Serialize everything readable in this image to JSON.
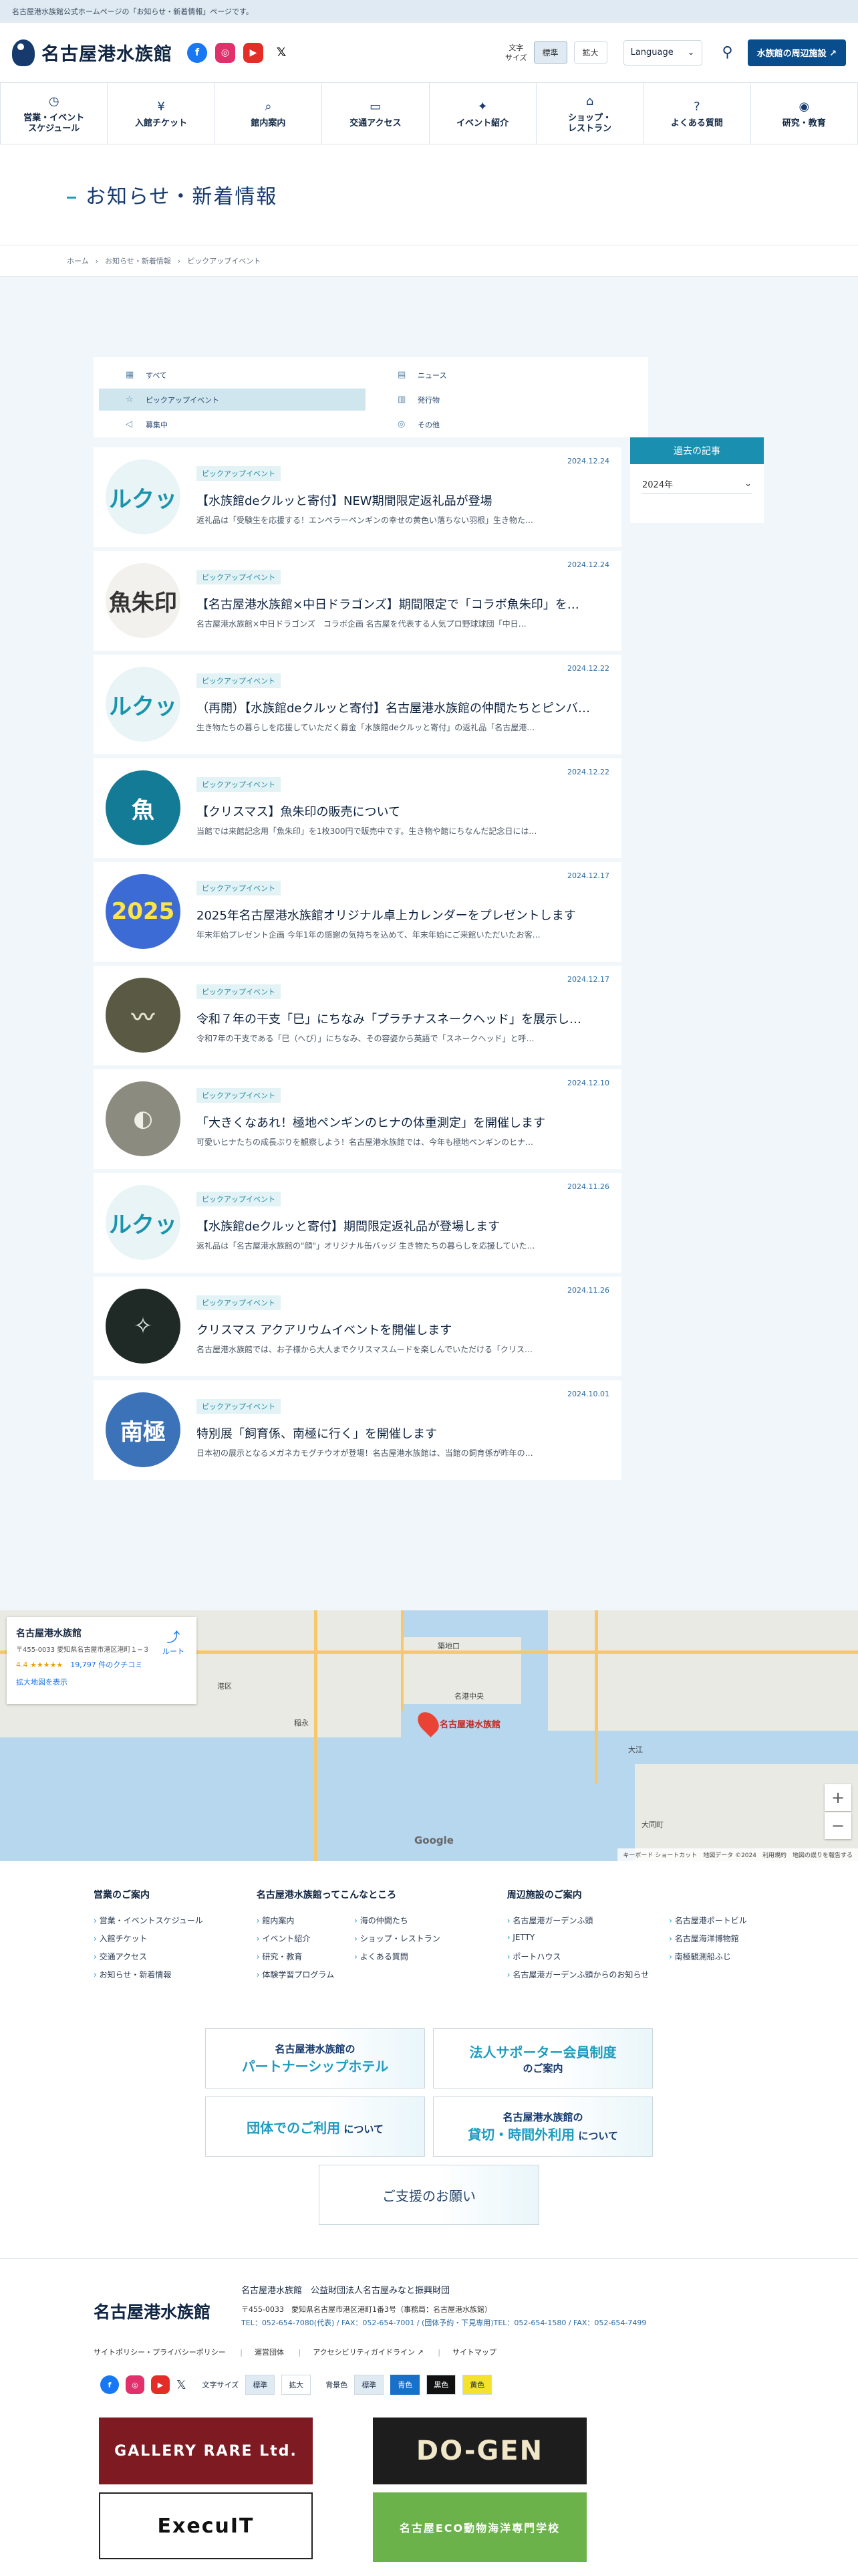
{
  "topbar": {
    "text": "名古屋港水族館公式ホームページの「お知らせ・新着情報」ページです。"
  },
  "header": {
    "logo_text": "名古屋港水族館",
    "sns": {
      "facebook": "f",
      "instagram": "◎",
      "youtube": "▶",
      "x": "𝕏"
    },
    "font_size_label": "文字\nサイズ",
    "font_standard": "標準",
    "font_large": "拡大",
    "language": "Language",
    "nearby_button": "水族館の周辺施設 ↗"
  },
  "gnav": [
    {
      "label": "営業・イベント\nスケジュール",
      "icon": "clock-icon",
      "glyph": "◷"
    },
    {
      "label": "入館チケット",
      "icon": "ticket-icon",
      "glyph": "¥"
    },
    {
      "label": "館内案内",
      "icon": "map-search-icon",
      "glyph": "⌕"
    },
    {
      "label": "交通アクセス",
      "icon": "bus-icon",
      "glyph": "▭"
    },
    {
      "label": "イベント紹介",
      "icon": "event-icon",
      "glyph": "✦"
    },
    {
      "label": "ショップ・\nレストラン",
      "icon": "shop-icon",
      "glyph": "⌂"
    },
    {
      "label": "よくある質問",
      "icon": "question-icon",
      "glyph": "?"
    },
    {
      "label": "研究・教育",
      "icon": "research-icon",
      "glyph": "◉"
    }
  ],
  "page": {
    "title": "お知らせ・新着情報"
  },
  "breadcrumb": [
    "ホーム",
    "お知らせ・新着情報",
    "ピックアップイベント"
  ],
  "filters": [
    {
      "label": "すべて",
      "icon": "grid-icon",
      "glyph": "▦",
      "active": false
    },
    {
      "label": "ニュース",
      "icon": "news-icon",
      "glyph": "▤",
      "active": false
    },
    {
      "label": "ピックアップイベント",
      "icon": "pickup-icon",
      "glyph": "☆",
      "active": true
    },
    {
      "label": "発行物",
      "icon": "book-icon",
      "glyph": "▥",
      "active": false
    },
    {
      "label": "募集中",
      "icon": "megaphone-icon",
      "glyph": "◁",
      "active": false
    },
    {
      "label": "その他",
      "icon": "other-icon",
      "glyph": "◎",
      "active": false
    }
  ],
  "archive": {
    "title": "過去の記事",
    "year": "2024年"
  },
  "tag_label": "ピックアップイベント",
  "articles": [
    {
      "date": "2024.12.24",
      "title": "【水族館deクルッと寄付】NEW期間限定返礼品が登場",
      "excerpt": "返礼品は「受験生を応援する！エンペラーペンギンの幸せの黄色い落ちない羽根」生き物た…",
      "thumb": "ルクッ",
      "bg": "#e9f4f6",
      "fg": "#1a93ad"
    },
    {
      "date": "2024.12.24",
      "title": "【名古屋港水族館×中日ドラゴンズ】期間限定で「コラボ魚朱印」を…",
      "excerpt": "名古屋港水族館×中日ドラゴンズ　コラボ企画 名古屋を代表する人気プロ野球球団「中日…",
      "thumb": "魚朱印",
      "bg": "#f3f1ee",
      "fg": "#333"
    },
    {
      "date": "2024.12.22",
      "title": "（再開）【水族館deクルッと寄付】名古屋港水族館の仲間たちとピンバ…",
      "excerpt": "生き物たちの暮らしを応援していただく募金「水族館deクルッと寄付」の返礼品「名古屋港…",
      "thumb": "ルクッ",
      "bg": "#e9f4f6",
      "fg": "#1a93ad"
    },
    {
      "date": "2024.12.22",
      "title": "【クリスマス】魚朱印の販売について",
      "excerpt": "当館では来館記念用「魚朱印」を1枚300円で販売中です。生き物や館にちなんだ記念日には…",
      "thumb": "魚",
      "bg": "#137b96",
      "fg": "#fff"
    },
    {
      "date": "2024.12.17",
      "title": "2025年名古屋港水族館オリジナル卓上カレンダーをプレゼントします",
      "excerpt": "年末年始プレゼント企画 今年1年の感謝の気持ちを込めて、年末年始にご来館いただいたお客…",
      "thumb": "2025",
      "bg": "#3d6bd6",
      "fg": "#ffe34d"
    },
    {
      "date": "2024.12.17",
      "title": "令和７年の干支「巳」にちなみ「プラチナスネークヘッド」を展示し…",
      "excerpt": "令和7年の干支である「巳（へび）」にちなみ、その容姿から英語で「スネークヘッド」と呼…",
      "thumb": "〰",
      "bg": "#5a5a44",
      "fg": "#e6e0c8"
    },
    {
      "date": "2024.12.10",
      "title": "「大きくなあれ！極地ペンギンのヒナの体重測定」を開催します",
      "excerpt": "可愛いヒナたちの成長ぶりを観察しよう！名古屋港水族館では、今年も極地ペンギンのヒナ…",
      "thumb": "◐",
      "bg": "#8b8b80",
      "fg": "#efefe8"
    },
    {
      "date": "2024.11.26",
      "title": "【水族館deクルッと寄付】期間限定返礼品が登場します",
      "excerpt": "返礼品は「名古屋港水族館の\"顔\"」オリジナル缶バッジ 生き物たちの暮らしを応援していた…",
      "thumb": "ルクッ",
      "bg": "#e9f4f6",
      "fg": "#1a93ad"
    },
    {
      "date": "2024.11.26",
      "title": "クリスマス アクアリウムイベントを開催します",
      "excerpt": "名古屋港水族館では、お子様から大人までクリスマスムードを楽しんでいただける「クリス…",
      "thumb": "✧",
      "bg": "#1f2a26",
      "fg": "#dbe8e0"
    },
    {
      "date": "2024.10.01",
      "title": "特別展「飼育係、南極に行く」を開催します",
      "excerpt": "日本初の展示となるメガネカモグチウオが登場！名古屋港水族館は、当館の飼育係が昨年の…",
      "thumb": "南極",
      "bg": "#3b72b8",
      "fg": "#fff"
    }
  ],
  "map": {
    "name": "名古屋港水族館",
    "address": "〒455-0033 愛知県名古屋市港区港町１−３",
    "route": "ルート",
    "rating": "4.4 ★★★★★",
    "reviews": "19,797 件のクチコミ",
    "enlarge": "拡大地図を表示",
    "pin_label": "名古屋港水族館",
    "google": "Google",
    "attribution": "キーボード ショートカット　地図データ ©2024　利用規約　地図の誤りを報告する",
    "zoom_in": "+",
    "zoom_out": "−",
    "labels": [
      "港区",
      "築地口",
      "稲永",
      "大江",
      "名古屋港水族館",
      "名港中央",
      "大同町"
    ]
  },
  "footer_nav": [
    {
      "heading": "営業のご案内",
      "items": [
        "営業・イベントスケジュール",
        "入館チケット",
        "交通アクセス",
        "お知らせ・新着情報"
      ]
    },
    {
      "heading": "名古屋港水族館ってこんなところ",
      "items": [
        "館内案内",
        "海の仲間たち",
        "イベント紹介",
        "ショップ・レストラン",
        "研究・教育",
        "よくある質問",
        "体験学習プログラム"
      ]
    },
    {
      "heading": "周辺施設のご案内",
      "items": [
        "名古屋港ガーデンふ頭",
        "名古屋港ポートビル",
        "JETTY",
        "名古屋海洋博物館",
        "ポートハウス",
        "南極観測船ふじ",
        "名古屋港ガーデンふ頭からのお知らせ"
      ]
    }
  ],
  "banners": {
    "hotel_line1": "名古屋港水族館の",
    "hotel_line2": "パートナーシップホテル",
    "supporter_line1": "法人サポーター会員制度",
    "supporter_line2": "のご案内",
    "group_line1": "団体でのご利用",
    "group_line2": "について",
    "rental_line1": "名古屋港水族館の",
    "rental_line2": "貸切・時間外利用",
    "rental_line3": "について",
    "support": "ご支援のお願い"
  },
  "footer_info": {
    "logo_text": "名古屋港水族館",
    "org": "名古屋港水族館　公益財団法人名古屋みなと振興財団",
    "address": "〒455-0033　愛知県名古屋市港区港町1番3号（事務局：名古屋港水族館）",
    "tel": "TEL：052-654-7080(代表) / FAX：052-654-7001 / (団体予約・下見専用)TEL：052-654-1580 / FAX：052-654-7499"
  },
  "policy_links": [
    "サイトポリシー・プライバシーポリシー",
    "運営団体",
    "アクセシビリティガイドライン ↗",
    "サイトマップ"
  ],
  "footer_tools": {
    "font_label": "文字サイズ",
    "standard": "標準",
    "large": "拡大",
    "bg_label": "背景色",
    "bg_standard": "標準",
    "blue": "青色",
    "black": "黒色",
    "yellow": "黄色"
  },
  "sponsors": [
    "GALLERY RARE Ltd.",
    "DO-GEN",
    "ExecuIT",
    "名古屋ECO動物海洋専門学校"
  ]
}
